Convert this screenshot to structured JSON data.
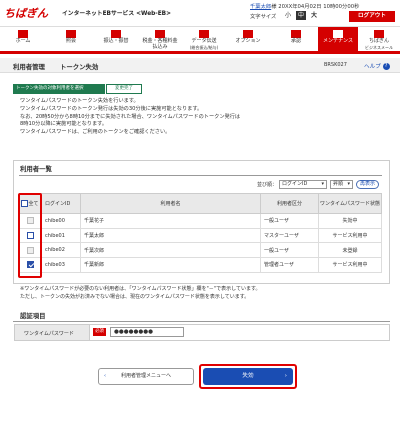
{
  "header": {
    "logo": "ちばぎん",
    "service": "インターネットEBサービス <Web-EB>",
    "user_name": "千葉太郎",
    "user_suffix": "様",
    "last_login": "20XX年04月02日 10時00分00秒",
    "font_size_label": "文字サイズ",
    "font_sizes": [
      "小",
      "中",
      "大"
    ],
    "logout": "ログアウト"
  },
  "nav": [
    {
      "label": "ホーム",
      "label2": ""
    },
    {
      "label": "照会",
      "label2": ""
    },
    {
      "label": "振込・振替",
      "label2": ""
    },
    {
      "label": "税金・各種料金",
      "label2": "払込み"
    },
    {
      "label": "データ伝送",
      "label2": "(総合振込/給与)"
    },
    {
      "label": "オプション",
      "label2": ""
    },
    {
      "label": "承認",
      "label2": ""
    },
    {
      "label": "メンテナンス",
      "label2": ""
    },
    {
      "label": "ちばぎん",
      "label2": "ビジネスメール"
    }
  ],
  "page": {
    "breadcrumb": "利用者管理",
    "title": "トークン失効",
    "screen_id": "BRSK027",
    "help": "ヘルプ"
  },
  "steps": [
    "トークン失効の対象利用者を選択",
    "変更完了"
  ],
  "message": [
    "ワンタイムパスワードのトークン失効を行います。",
    "ワンタイムパスワードのトークン発行は失効の30分後に実施可能となります。",
    "なお、20時50分から8時10分までに失効された場合、ワンタイムパスワードのトークン発行は",
    "8時10分以降に実施可能となります。",
    "ワンタイムパスワードは、ご利用のトークンをご確認ください。"
  ],
  "user_list": {
    "title": "利用者一覧",
    "sort_label": "並び順：",
    "sort_value": "ログインID",
    "order_value": "昇順",
    "resort": "再表示",
    "columns": [
      "全て",
      "ログインID",
      "利用者名",
      "利用者区分",
      "ワンタイムパスワード状態"
    ],
    "rows": [
      {
        "id": "chibe00",
        "name": "千葉花子",
        "type": "一般ユーザ",
        "status": "失効中",
        "state": "disabled"
      },
      {
        "id": "chibe01",
        "name": "千葉太郎",
        "type": "マスターユーザ",
        "status": "サービス利用中",
        "state": "unchecked"
      },
      {
        "id": "chibe02",
        "name": "千葉次郎",
        "type": "一般ユーザ",
        "status": "未登録",
        "state": "disabled"
      },
      {
        "id": "chibe03",
        "name": "千葉新郎",
        "type": "管理者ユーザ",
        "status": "サービス利用中",
        "state": "checked"
      }
    ],
    "note1": "※ワンタイムパスワードが必要のない利用者は、「ワンタイムパスワード状態」欄を\"－\"で表示しています。",
    "note2": "ただし、トークンの失効がお済みでない場合は、現在のワンタイムパスワード状態を表示しています。"
  },
  "auth": {
    "title": "認証項目",
    "label": "ワンタイムパスワード",
    "required": "必須",
    "value": "●●●●●●●●"
  },
  "buttons": {
    "back": "利用者管理メニューへ",
    "execute": "失効"
  }
}
